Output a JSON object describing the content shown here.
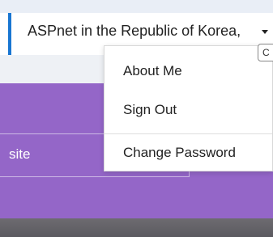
{
  "header": {
    "user_menu_label": "ASPnet in the Republic of Korea,"
  },
  "dropdown": {
    "items": [
      {
        "label": "About Me"
      },
      {
        "label": "Sign Out"
      },
      {
        "label": "Change Password"
      }
    ]
  },
  "hero": {
    "site_label": "site"
  },
  "tooltip": {
    "label": "C"
  },
  "colors": {
    "accent": "#1976d2",
    "hero": "#9466c8"
  }
}
